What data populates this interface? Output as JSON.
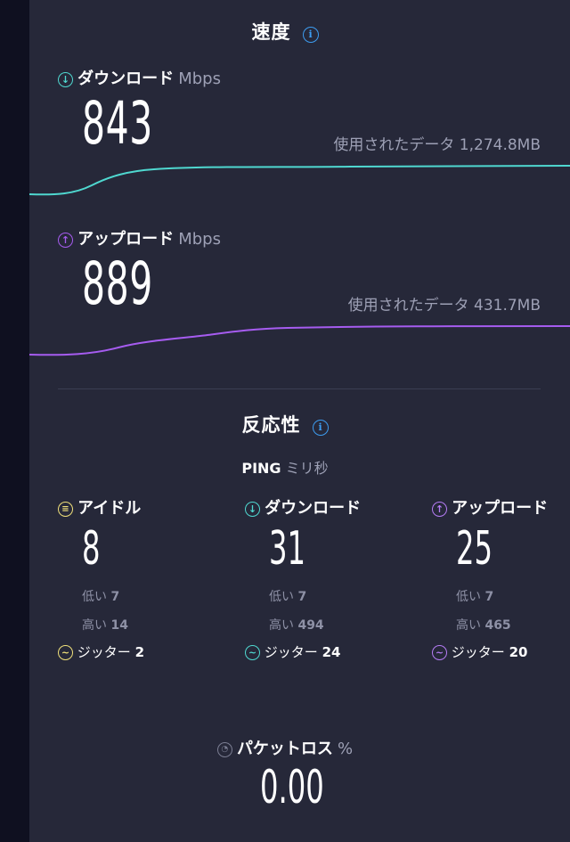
{
  "speed": {
    "title": "速度",
    "download": {
      "label": "ダウンロード",
      "unit": "Mbps",
      "value": "843",
      "data_used": "使用されたデータ 1,274.8MB",
      "color": "#4fd8d0"
    },
    "upload": {
      "label": "アップロード",
      "unit": "Mbps",
      "value": "889",
      "data_used": "使用されたデータ 431.7MB",
      "color": "#a65cf0"
    }
  },
  "responsiveness": {
    "title": "反応性",
    "ping_label": "PING",
    "ping_unit": "ミリ秒",
    "idle": {
      "label": "アイドル",
      "value": "8",
      "low_label": "低い",
      "low": "7",
      "high_label": "高い",
      "high": "14",
      "jitter_label": "ジッター",
      "jitter": "2",
      "color": "#f0e07a"
    },
    "download": {
      "label": "ダウンロード",
      "value": "31",
      "low_label": "低い",
      "low": "7",
      "high_label": "高い",
      "high": "494",
      "jitter_label": "ジッター",
      "jitter": "24",
      "color": "#4fd8d0"
    },
    "upload": {
      "label": "アップロード",
      "value": "25",
      "low_label": "低い",
      "low": "7",
      "high_label": "高い",
      "high": "465",
      "jitter_label": "ジッター",
      "jitter": "20",
      "color": "#b57cf5"
    }
  },
  "packet_loss": {
    "label": "パケットロス",
    "unit": "%",
    "value": "0.00"
  },
  "icons": {
    "info": "info-icon",
    "download": "arrow-down-circle-icon",
    "upload": "arrow-up-circle-icon",
    "idle": "idle-icon",
    "jitter": "wave-icon",
    "packet_loss": "gauge-icon"
  },
  "accent": "#3d9cf0"
}
